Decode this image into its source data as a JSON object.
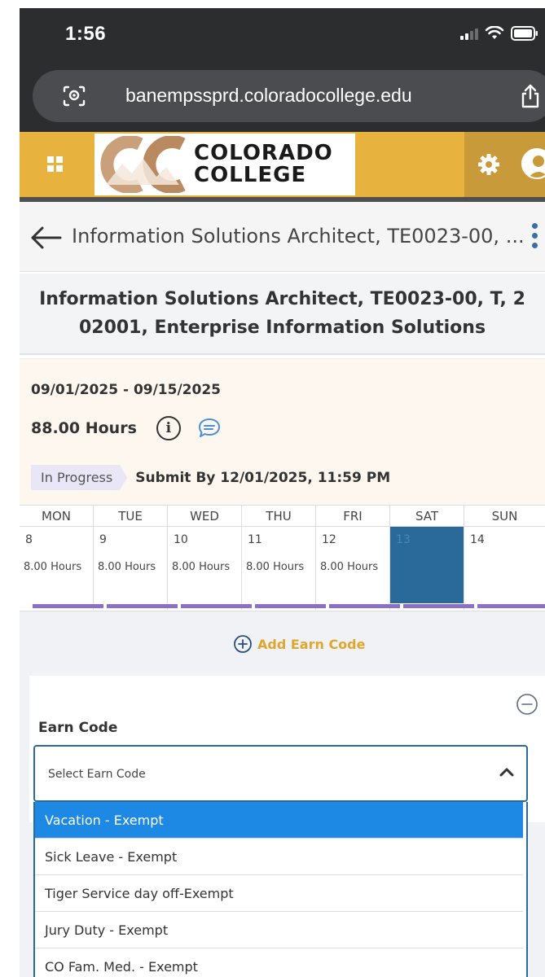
{
  "status_bar": {
    "time": "1:56"
  },
  "browser": {
    "url": "banempssprd.coloradocollege.edu"
  },
  "header": {
    "logo_line1": "COLORADO",
    "logo_line2": "COLLEGE"
  },
  "nav": {
    "title": "Information Solutions Architect, TE0023-00, ..."
  },
  "page": {
    "heading": "Information Solutions Architect, TE0023-00, T, 2 02001, Enterprise Information Solutions"
  },
  "summary": {
    "date_range": "09/01/2025 - 09/15/2025",
    "total_hours": "88.00 Hours",
    "status": "In Progress",
    "submit_by": "Submit By 12/01/2025, 11:59 PM"
  },
  "week": {
    "days": [
      {
        "name": "MON",
        "num": "8",
        "hours": "8.00 Hours"
      },
      {
        "name": "TUE",
        "num": "9",
        "hours": "8.00 Hours"
      },
      {
        "name": "WED",
        "num": "10",
        "hours": "8.00 Hours"
      },
      {
        "name": "THU",
        "num": "11",
        "hours": "8.00 Hours"
      },
      {
        "name": "FRI",
        "num": "12",
        "hours": "8.00 Hours"
      },
      {
        "name": "SAT",
        "num": "13",
        "hours": ""
      },
      {
        "name": "SUN",
        "num": "14",
        "hours": ""
      }
    ],
    "selected_day": "13"
  },
  "earn": {
    "add_label": "Add Earn Code",
    "field_label": "Earn Code",
    "placeholder": "Select Earn Code",
    "options": [
      "Vacation - Exempt",
      "Sick Leave - Exempt",
      "Tiger Service day off-Exempt",
      "Jury Duty - Exempt",
      "CO Fam. Med. - Exempt"
    ],
    "highlighted_option": "Vacation - Exempt"
  },
  "colors": {
    "header_gold": "#e8b23f",
    "accent_blue": "#2a6a9a",
    "highlight_blue": "#1e88e5",
    "period_bar": "#8b6fc9",
    "add_link": "#e0a72e"
  }
}
